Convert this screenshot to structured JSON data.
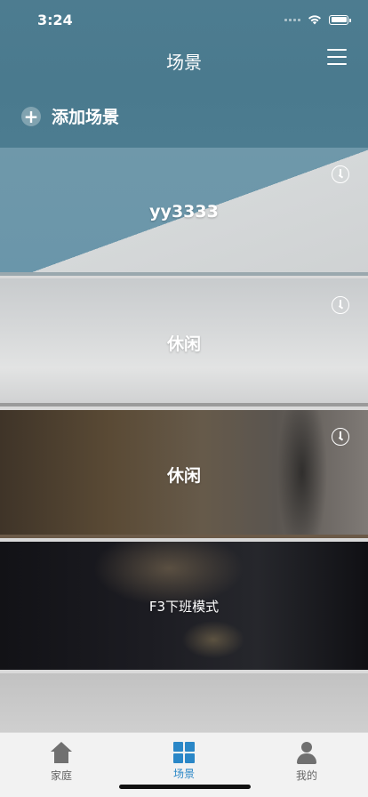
{
  "status_bar": {
    "time": "3:24"
  },
  "header": {
    "title": "场景",
    "menu_icon": "hamburger-menu-icon"
  },
  "add_scene": {
    "label": "添加场景",
    "icon": "plus-circle-icon"
  },
  "scenes": [
    {
      "name": "yy3333",
      "has_timer": true
    },
    {
      "name": "休闲",
      "has_timer": true
    },
    {
      "name": "休闲",
      "has_timer": true
    },
    {
      "name": "F3下班模式",
      "has_timer": false
    }
  ],
  "tabs": [
    {
      "label": "家庭",
      "icon": "home-icon",
      "active": false
    },
    {
      "label": "场景",
      "icon": "grid-icon",
      "active": true
    },
    {
      "label": "我的",
      "icon": "person-icon",
      "active": false
    }
  ],
  "colors": {
    "header_bg": "#4c7c90",
    "active_tab": "#2a87c7",
    "tabbar_bg": "#f2f2f2"
  }
}
